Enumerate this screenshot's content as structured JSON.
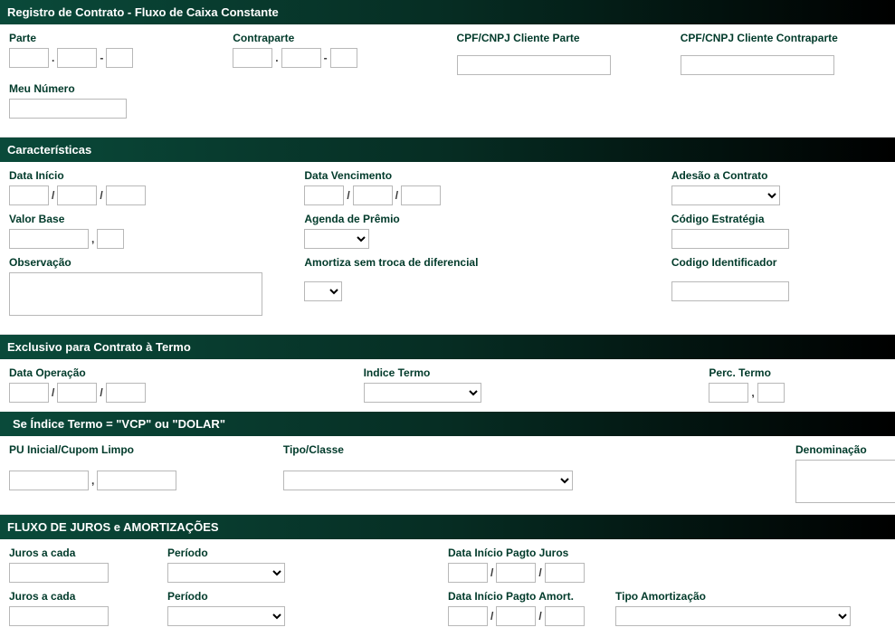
{
  "headers": {
    "main": "Registro de Contrato - Fluxo de Caixa Constante",
    "caracteristicas": "Características",
    "exclusivo": "Exclusivo para Contrato à Termo",
    "indice_sub": "Se Índice Termo = \"VCP\" ou \"DOLAR\"",
    "fluxo": "FLUXO DE JUROS e AMORTIZAÇÕES"
  },
  "labels": {
    "parte": "Parte",
    "contraparte": "Contraparte",
    "cpf_parte": "CPF/CNPJ Cliente Parte",
    "cpf_contraparte": "CPF/CNPJ Cliente Contraparte",
    "meu_numero": "Meu Número",
    "data_inicio": "Data Início",
    "data_venc": "Data Vencimento",
    "adesao": "Adesão a Contrato",
    "valor_base": "Valor Base",
    "agenda_premio": "Agenda de Prêmio",
    "codigo_estrategia": "Código Estratégia",
    "observacao": "Observação",
    "amortiza": "Amortiza sem troca de diferencial",
    "codigo_ident": "Codigo Identificador",
    "data_operacao": "Data Operação",
    "indice_termo": "Indice Termo",
    "perc_termo": "Perc. Termo",
    "pu_inicial": "PU Inicial/Cupom Limpo",
    "tipo_classe": "Tipo/Classe",
    "denominacao": "Denominação",
    "juros_cada": "Juros a cada",
    "periodo": "Período",
    "data_pagto_juros": "Data Início Pagto Juros",
    "data_pagto_amort": "Data Início Pagto Amort.",
    "tipo_amort": "Tipo Amortização"
  },
  "sep": {
    "dot": ".",
    "dash": "-",
    "slash": "/",
    "comma": ","
  }
}
